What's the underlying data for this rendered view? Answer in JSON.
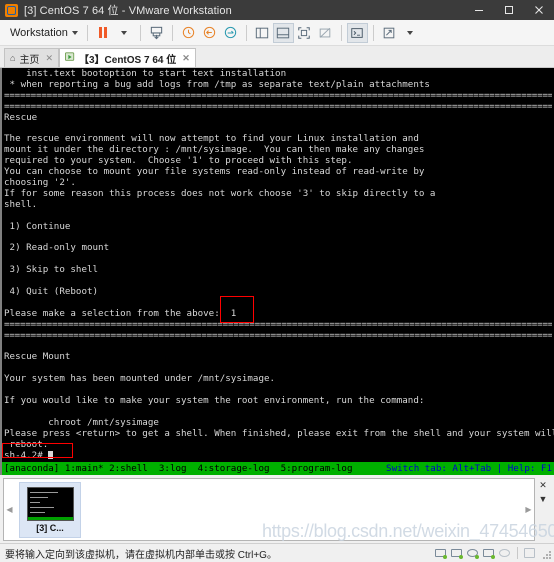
{
  "window": {
    "title": "[3] CentOS 7 64 位 - VMware Workstation",
    "app_icon": "vmware-icon",
    "minimize_label": "—",
    "maximize_label": "▢",
    "close_label": "✕"
  },
  "toolbar": {
    "menu_label": "Workstation",
    "buttons": [
      {
        "name": "pause-button",
        "glyph": ""
      },
      {
        "name": "pause-dropdown",
        "glyph": "▾"
      },
      {
        "name": "snapshot-button",
        "glyph": "⎙"
      },
      {
        "name": "take-snapshot-button",
        "glyph": "◷"
      },
      {
        "name": "revert-snapshot-button",
        "glyph": "◶"
      },
      {
        "name": "snapshot-manager-button",
        "glyph": "◵"
      },
      {
        "name": "show-sidebar-button",
        "glyph": "▯"
      },
      {
        "name": "show-thumbnail-bar-button",
        "glyph": "▤"
      },
      {
        "name": "full-screen-button",
        "glyph": "⛶"
      },
      {
        "name": "unity-mode-button",
        "glyph": "⛶"
      },
      {
        "name": "console-button",
        "glyph": ">_"
      },
      {
        "name": "send-ctrl-alt-del-button",
        "glyph": "⬓"
      },
      {
        "name": "more-dropdown",
        "glyph": "▾"
      }
    ]
  },
  "tabs": [
    {
      "name": "tab-home",
      "label": "主页",
      "icon": "home-icon",
      "active": false,
      "close": "✕"
    },
    {
      "name": "tab-centos",
      "label": "【3】CentOS 7 64 位",
      "icon": "vm-icon",
      "active": true,
      "close": "✕"
    }
  ],
  "terminal": {
    "lines": [
      "    inst.text bootoption to start text installation",
      " * when reporting a bug add logs from /tmp as separate text/plain attachments",
      "SEP",
      "SEP",
      "Rescue",
      "",
      "The rescue environment will now attempt to find your Linux installation and",
      "mount it under the directory : /mnt/sysimage.  You can then make any changes",
      "required to your system.  Choose '1' to proceed with this step.",
      "You can choose to mount your file systems read-only instead of read-write by",
      "choosing '2'.",
      "If for some reason this process does not work choose '3' to skip directly to a",
      "shell.",
      "",
      " 1) Continue",
      "",
      " 2) Read-only mount",
      "",
      " 3) Skip to shell",
      "",
      " 4) Quit (Reboot)",
      "",
      "Please make a selection from the above:  1",
      "SEP",
      "SEP",
      "",
      "Rescue Mount",
      "",
      "Your system has been mounted under /mnt/sysimage.",
      "",
      "If you would like to make your system the root environment, run the command:",
      "",
      "        chroot /mnt/sysimage",
      "Please press <return> to get a shell. When finished, please exit from the shell and your system will",
      " reboot.",
      "sh-4.2# "
    ],
    "separator_char": "=",
    "prompt": "sh-4.2#",
    "selection_value": "1",
    "highlight_color": "#ff0000",
    "bg_color": "#000000",
    "fg_color": "#d8d8d8"
  },
  "tmux_status": {
    "left": "[anaconda] 1:main* 2:shell  3:log  4:storage-log  5:program-log",
    "right": "Switch tab: Alt+Tab | Help: F1",
    "bg_color": "#00b000",
    "fg_color": "#0000cc"
  },
  "thumbnail_panel": {
    "left_arrow": "◀",
    "right_arrow": "▶",
    "close_label": "✕",
    "dropdown_label": "▼",
    "items": [
      {
        "name": "thumbnail-centos",
        "label": "[3] C..."
      }
    ]
  },
  "watermark": {
    "text": "https://blog.csdn.net/weixin_47454650"
  },
  "statusbar": {
    "message": "要将输入定向到该虚拟机，请在虚拟机内部单击或按 Ctrl+G。",
    "icons": [
      {
        "name": "hard-disk-icon"
      },
      {
        "name": "network-adapter-icon"
      },
      {
        "name": "cd-dvd-icon"
      },
      {
        "name": "usb-controller-icon"
      },
      {
        "name": "printer-icon"
      },
      {
        "name": "sound-card-icon"
      }
    ]
  }
}
